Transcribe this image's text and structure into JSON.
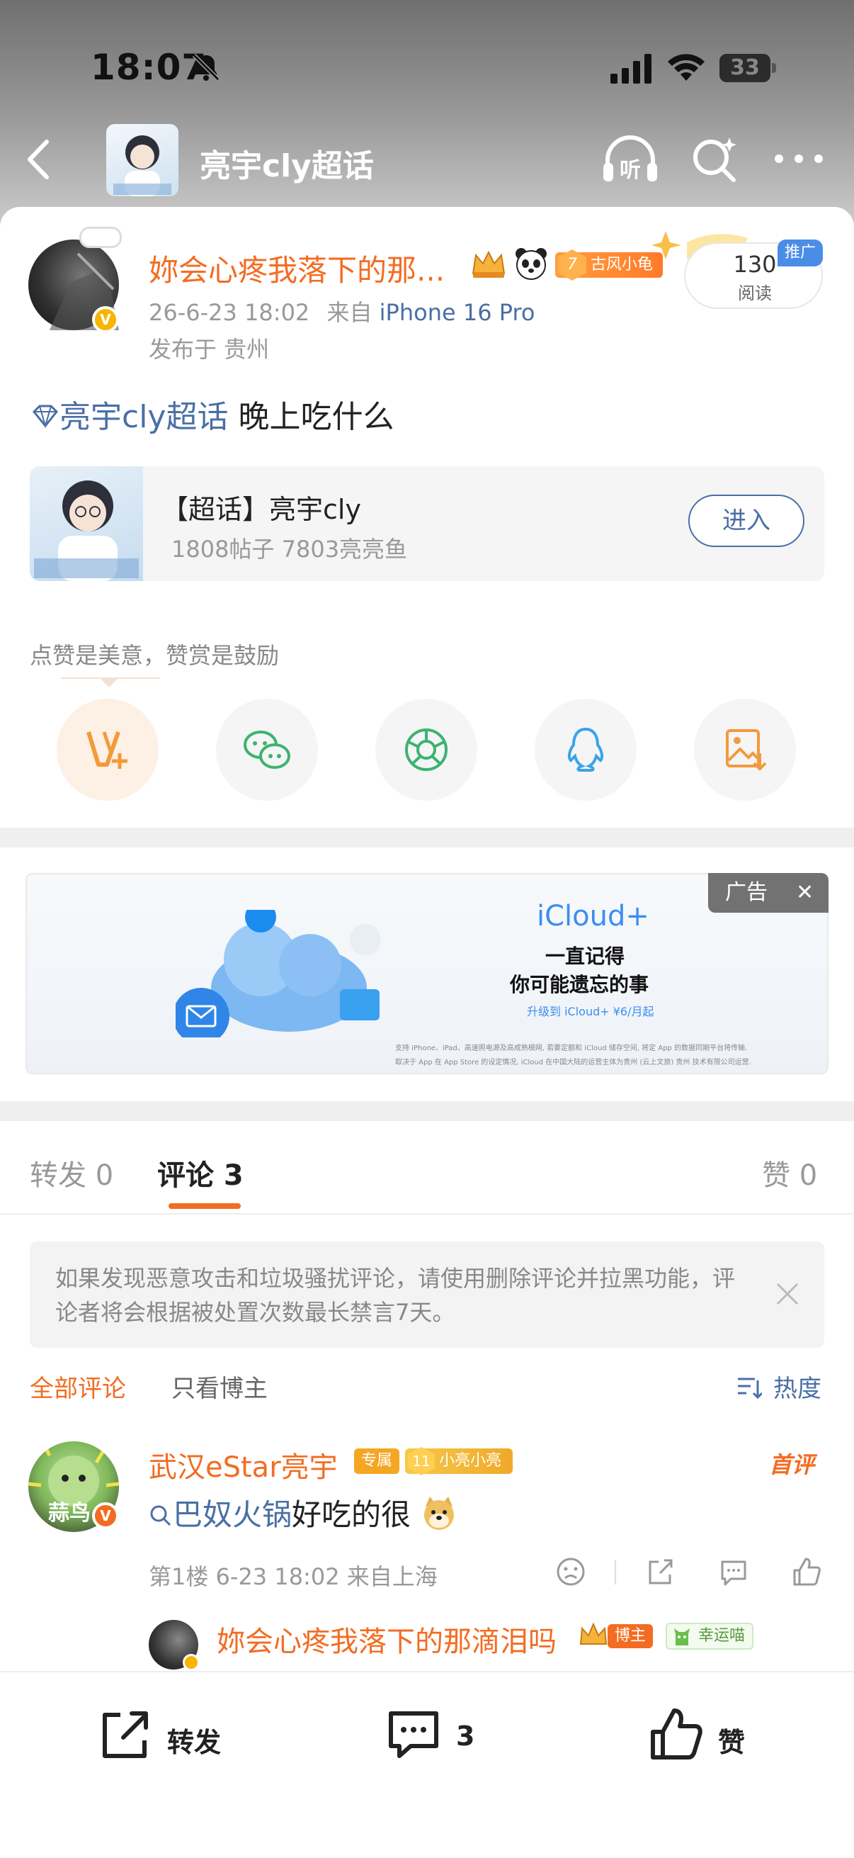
{
  "status_bar": {
    "time": "18:07",
    "battery": "33"
  },
  "nav": {
    "title": "亮宇cly超话"
  },
  "post": {
    "username": "妳会心疼我落下的那...",
    "level_badge": "古风小龟",
    "level_num": "7",
    "meta_time": "26-6-23 18:02",
    "meta_from": "来自",
    "device": "iPhone 16 Pro",
    "location": "发布于 贵州",
    "read_count": "130",
    "read_label": "阅读",
    "promo": "推广",
    "topic": "亮宇cly超话",
    "text": " 晚上吃什么"
  },
  "topic_card": {
    "title": "【超话】亮宇cly",
    "stats": "1808帖子 7803亮亮鱼",
    "enter": "进入"
  },
  "like_hint": "点赞是美意，赞赏是鼓励",
  "share_icons": [
    "reward-icon",
    "wechat-icon",
    "moments-icon",
    "qq-icon",
    "save-image-icon"
  ],
  "ad": {
    "brand": "iCloud+",
    "line1": "一直记得",
    "line2": "你可能遗忘的事",
    "cta": "升级到 iCloud+ ¥6/月起",
    "fine1": "支持 iPhone、iPad、高速照电源及高成熟模网, 若要定额和 iCloud 储存空间, 将定 App 的数据同期平台将传输.",
    "fine2": "取决于 App 在 App Store 的设定情况, iCloud 在中国大陆的运营主体为贵州 (云上文旅) 贵州 技术有限公司运营.",
    "tag": "广告"
  },
  "tabs": {
    "repost": "转发 0",
    "comments": "评论 3",
    "likes": "赞 0"
  },
  "notice": "如果发现恶意攻击和垃圾骚扰评论，请使用删除评论并拉黑功能，评论者将会根据被处置次数最长禁言7天。",
  "filters": {
    "all": "全部评论",
    "author": "只看博主",
    "sort": "热度"
  },
  "comment": {
    "avatar_label": "蒜鸟",
    "name": "武汉eStar亮宇",
    "tag": "专属",
    "fan_level": "11",
    "fan_name": "小亮小亮",
    "first": "首评",
    "link": "巴奴火锅",
    "text": "好吃的很",
    "meta": "第1楼 6-23 18:02 来自上海"
  },
  "reply": {
    "name": "妳会心疼我落下的那滴泪吗",
    "tag": "博主",
    "lucky": "幸运喵"
  },
  "bottom_bar": {
    "repost": "转发",
    "comments": "3",
    "like": "赞"
  },
  "colors": {
    "accent": "#f36c21",
    "link": "#4a6fa5"
  }
}
